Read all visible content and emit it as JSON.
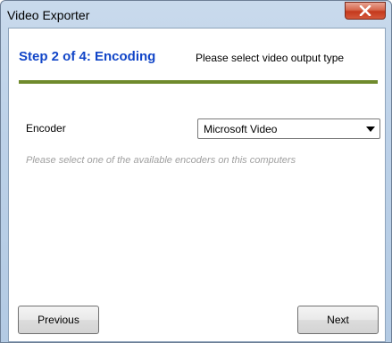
{
  "window": {
    "title": "Video Exporter",
    "close_icon": "close-icon"
  },
  "header": {
    "step_title": "Step 2 of 4: Encoding",
    "step_description": "Please select video output type",
    "accent_color": "#6f8a2c",
    "title_color": "#1246c8"
  },
  "encoder": {
    "label": "Encoder",
    "selected": "Microsoft Video",
    "dropdown_icon": "chevron-down-icon",
    "hint": "Please select one of the available encoders on this computers"
  },
  "buttons": {
    "previous": "Previous",
    "next": "Next"
  }
}
